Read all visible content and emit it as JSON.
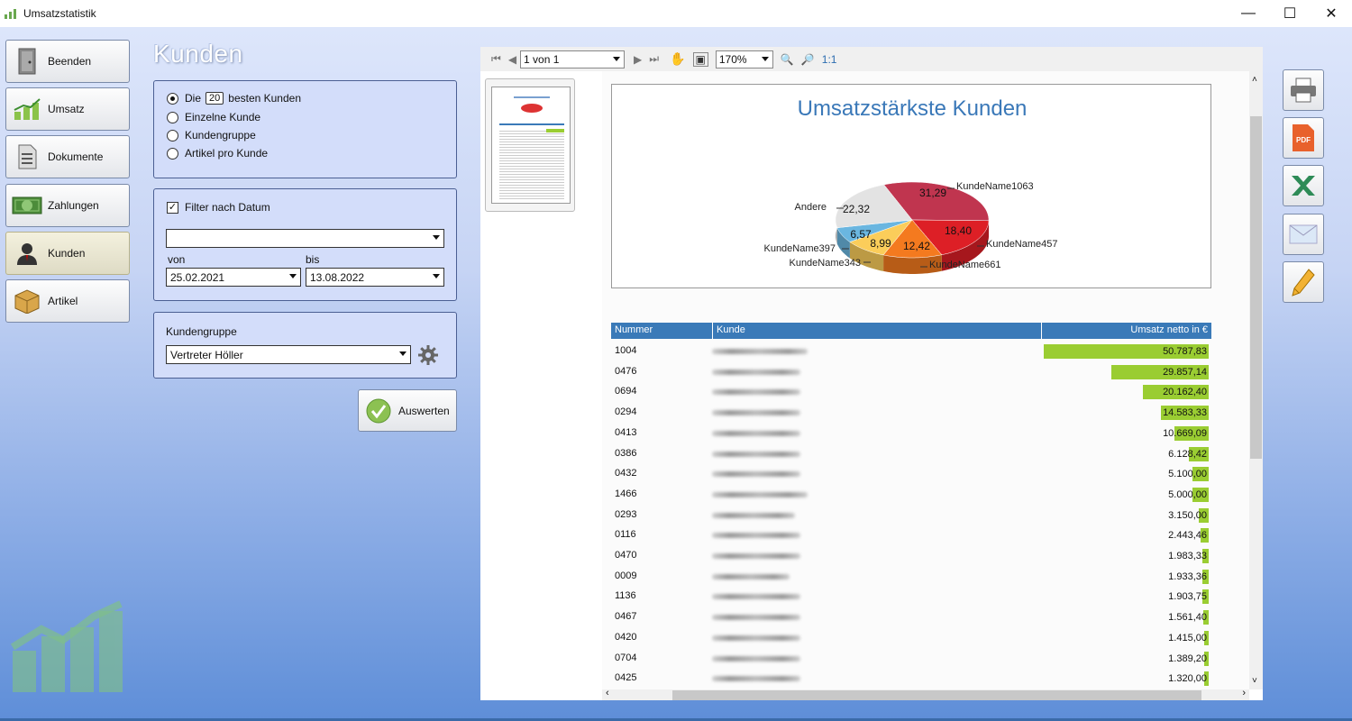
{
  "window": {
    "title": "Umsatzstatistik",
    "icon": "chart-icon"
  },
  "nav": [
    {
      "label": "Beenden",
      "icon": "door-icon"
    },
    {
      "label": "Umsatz",
      "icon": "chart-up-icon"
    },
    {
      "label": "Dokumente",
      "icon": "document-icon"
    },
    {
      "label": "Zahlungen",
      "icon": "money-icon"
    },
    {
      "label": "Kunden",
      "icon": "person-icon",
      "active": true
    },
    {
      "label": "Artikel",
      "icon": "box-icon"
    }
  ],
  "page": {
    "title": "Kunden"
  },
  "mode": {
    "options": [
      {
        "prefix": "Die",
        "count": "20",
        "suffix": "besten Kunden",
        "selected": true
      },
      {
        "label": "Einzelne Kunde",
        "selected": false
      },
      {
        "label": "Kundengruppe",
        "selected": false
      },
      {
        "label": "Artikel pro Kunde",
        "selected": false
      }
    ]
  },
  "date_filter": {
    "label": "Filter nach Datum",
    "checked": true,
    "preset": "",
    "von_label": "von",
    "bis_label": "bis",
    "von": "25.02.2021",
    "bis": "13.08.2022"
  },
  "group": {
    "label": "Kundengruppe",
    "value": "Vertreter Höller"
  },
  "evaluate_label": "Auswerten",
  "viewer": {
    "page_label": "1 von 1",
    "zoom": "170%",
    "one_to_one": "1:1"
  },
  "report": {
    "columns": [
      "Nummer",
      "Kunde",
      "Umsatz netto in €"
    ],
    "rows": [
      {
        "nummer": "1004",
        "umsatz": "50.787,83",
        "value": 50787.83
      },
      {
        "nummer": "0476",
        "umsatz": "29.857,14",
        "value": 29857.14
      },
      {
        "nummer": "0694",
        "umsatz": "20.162,40",
        "value": 20162.4
      },
      {
        "nummer": "0294",
        "umsatz": "14.583,33",
        "value": 14583.33
      },
      {
        "nummer": "0413",
        "umsatz": "10.669,09",
        "value": 10669.09
      },
      {
        "nummer": "0386",
        "umsatz": "6.128,42",
        "value": 6128.42
      },
      {
        "nummer": "0432",
        "umsatz": "5.100,00",
        "value": 5100.0
      },
      {
        "nummer": "1466",
        "umsatz": "5.000,00",
        "value": 5000.0
      },
      {
        "nummer": "0293",
        "umsatz": "3.150,00",
        "value": 3150.0
      },
      {
        "nummer": "0116",
        "umsatz": "2.443,46",
        "value": 2443.46
      },
      {
        "nummer": "0470",
        "umsatz": "1.983,33",
        "value": 1983.33
      },
      {
        "nummer": "0009",
        "umsatz": "1.933,36",
        "value": 1933.36
      },
      {
        "nummer": "1136",
        "umsatz": "1.903,75",
        "value": 1903.75
      },
      {
        "nummer": "0467",
        "umsatz": "1.561,40",
        "value": 1561.4
      },
      {
        "nummer": "0420",
        "umsatz": "1.415,00",
        "value": 1415.0
      },
      {
        "nummer": "0704",
        "umsatz": "1.389,20",
        "value": 1389.2
      },
      {
        "nummer": "0425",
        "umsatz": "1.320,00",
        "value": 1320.0
      }
    ]
  },
  "chart_data": {
    "type": "pie",
    "title": "Umsatzstärkste Kunden",
    "slices": [
      {
        "label": "KundeName1063",
        "value": 31.29,
        "color": "#c0354f"
      },
      {
        "label": "KundeName457",
        "value": 18.4,
        "color": "#dd1f26"
      },
      {
        "label": "KundeName661",
        "value": 12.42,
        "color": "#f47a1f"
      },
      {
        "label": "KundeName343",
        "value": 8.99,
        "color": "#fbcd5a"
      },
      {
        "label": "KundeName397",
        "value": 6.57,
        "color": "#6ab6e0"
      },
      {
        "label": "Andere",
        "value": 22.32,
        "color": "#e3e3e3"
      }
    ]
  },
  "actions": [
    {
      "name": "print-button",
      "icon": "printer-icon"
    },
    {
      "name": "pdf-button",
      "icon": "pdf-icon",
      "label": "PDF"
    },
    {
      "name": "excel-button",
      "icon": "excel-icon"
    },
    {
      "name": "email-button",
      "icon": "envelope-icon"
    },
    {
      "name": "edit-button",
      "icon": "pencil-icon"
    }
  ]
}
